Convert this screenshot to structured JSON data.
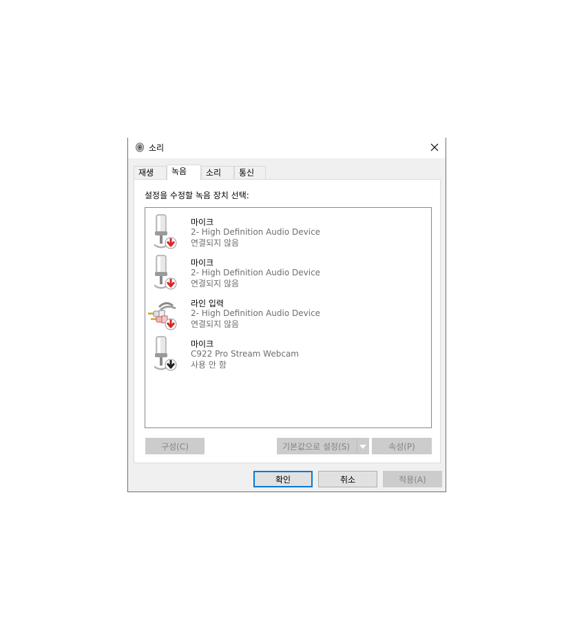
{
  "window": {
    "title": "소리",
    "icon": "speaker-icon",
    "close_icon": "close-icon"
  },
  "tabs": [
    {
      "label": "재생",
      "active": false
    },
    {
      "label": "녹음",
      "active": true
    },
    {
      "label": "소리",
      "active": false
    },
    {
      "label": "통신",
      "active": false
    }
  ],
  "panel": {
    "instruction": "설정을 수정할 녹음 장치 선택:",
    "devices": [
      {
        "name": "마이크",
        "subtitle": "2- High Definition Audio Device",
        "status": "연결되지 않음",
        "icon": "microphone-icon",
        "badge": "red-down-arrow-icon"
      },
      {
        "name": "마이크",
        "subtitle": "2- High Definition Audio Device",
        "status": "연결되지 않음",
        "icon": "microphone-icon",
        "badge": "red-down-arrow-icon"
      },
      {
        "name": "라인 입력",
        "subtitle": "2- High Definition Audio Device",
        "status": "연결되지 않음",
        "icon": "line-in-cable-icon",
        "badge": "red-down-arrow-icon"
      },
      {
        "name": "마이크",
        "subtitle": "C922 Pro Stream Webcam",
        "status": "사용 안 함",
        "icon": "microphone-icon",
        "badge": "black-down-arrow-icon"
      }
    ],
    "buttons": {
      "configure": "구성(C)",
      "set_default": "기본값으로 설정(S)",
      "properties": "속성(P)"
    }
  },
  "footer": {
    "ok": "확인",
    "cancel": "취소",
    "apply": "적용(A)"
  },
  "colors": {
    "accent": "#0078d7",
    "error_arrow": "#d9262a",
    "disabled_button": "#cccccc"
  }
}
